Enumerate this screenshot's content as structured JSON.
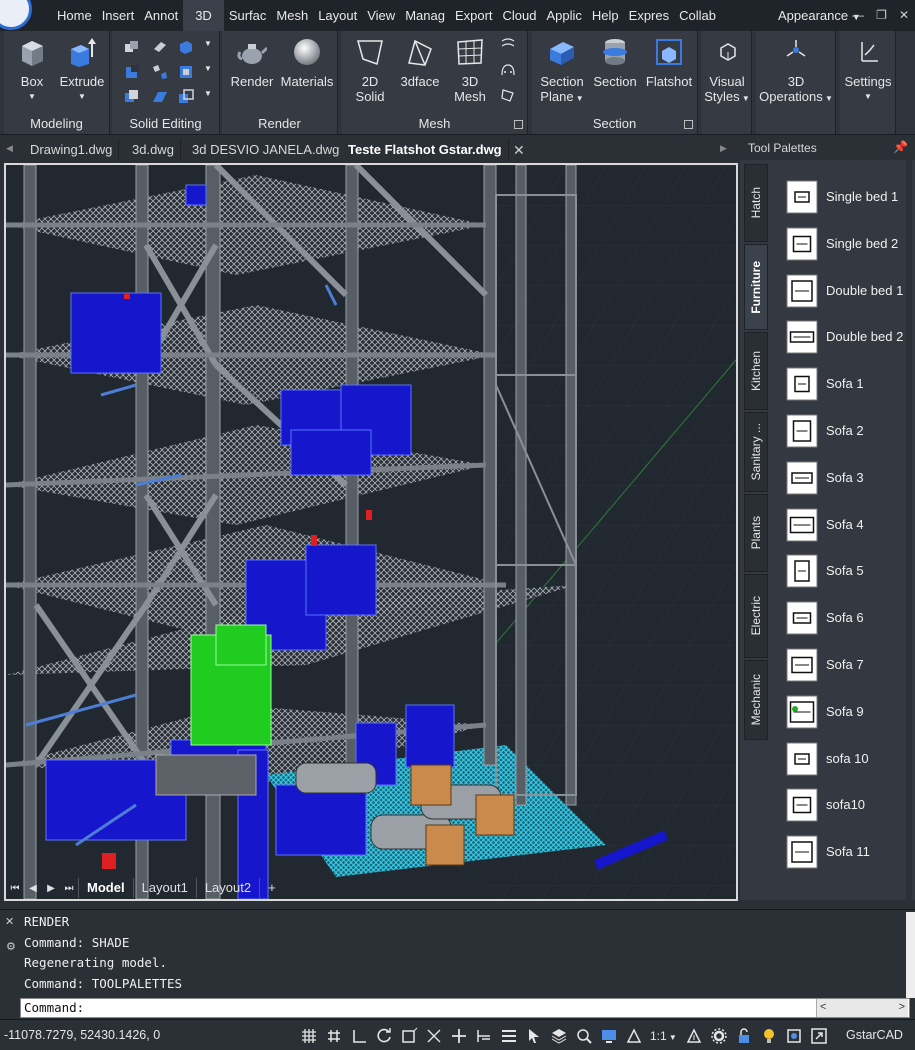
{
  "menubar": {
    "tabs": [
      "Home",
      "Insert",
      "Annot",
      "3D",
      "Surfac",
      "Mesh",
      "Layout",
      "View",
      "Manag",
      "Export",
      "Cloud",
      "Applic",
      "Help",
      "Expres",
      "Collab"
    ],
    "active_tab": "3D",
    "appearance_label": "Appearance"
  },
  "ribbon": {
    "modeling": {
      "title": "Modeling",
      "box": "Box",
      "extrude": "Extrude"
    },
    "solid_editing": {
      "title": "Solid Editing"
    },
    "render": {
      "title": "Render",
      "render": "Render",
      "materials": "Materials"
    },
    "mesh": {
      "title": "Mesh",
      "solid2d_line1": "2D",
      "solid2d_line2": "Solid",
      "face3d": "3dface",
      "mesh3d_line1": "3D",
      "mesh3d_line2": "Mesh"
    },
    "section": {
      "title": "Section",
      "plane_line1": "Section",
      "plane_line2": "Plane",
      "section": "Section",
      "flatshot": "Flatshot"
    },
    "visual_styles_line1": "Visual",
    "visual_styles_line2": "Styles",
    "ops_line1": "3D",
    "ops_line2": "Operations",
    "settings": "Settings"
  },
  "doc_tabs": [
    "Drawing1.dwg",
    "3d.dwg",
    "3d DESVIO JANELA.dwg",
    "Teste Flatshot Gstar.dwg"
  ],
  "active_doc": "Teste Flatshot Gstar.dwg",
  "layout_tabs": {
    "model": "Model",
    "layout1": "Layout1",
    "layout2": "Layout2",
    "add": "+"
  },
  "tool_palettes": {
    "title": "Tool Palettes",
    "tabs": [
      "Hatch",
      "Furniture",
      "Kitchen",
      "Sanitary ...",
      "Plants",
      "Electric",
      "Mechanic"
    ],
    "active_tab": "Furniture",
    "items": [
      "Single bed 1",
      "Single bed 2",
      "Double bed 1",
      "Double bed 2",
      "Sofa 1",
      "Sofa 2",
      "Sofa 3",
      "Sofa 4",
      "Sofa 5",
      "Sofa 6",
      "Sofa 7",
      "Sofa 9",
      "sofa 10",
      "sofa10",
      "Sofa 11"
    ]
  },
  "command": {
    "history": [
      "RENDER",
      "Command: SHADE",
      "Regenerating model.",
      "Command: TOOLPALETTES"
    ],
    "prompt": "Command:"
  },
  "status": {
    "coords": "-11078.7279, 52430.1426, 0",
    "scale": "1:1",
    "brand": "GstarCAD"
  },
  "colors": {
    "background": "#2b2f36",
    "viewport": "#212830",
    "accent": "#2c6fd6"
  }
}
